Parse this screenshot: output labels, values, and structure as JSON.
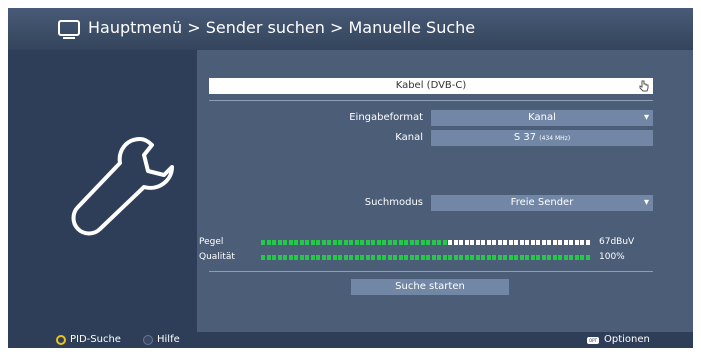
{
  "header": {
    "title": "Hauptmenü > Sender suchen > Manuelle Suche",
    "icon": "tv-icon"
  },
  "left_panel": {
    "icon": "wrench-icon"
  },
  "form": {
    "source": "Kabel (DVB-C)",
    "eingabeformat_label": "Eingabeformat",
    "eingabeformat_value": "Kanal",
    "kanal_label": "Kanal",
    "kanal_value": "S 37",
    "kanal_freq": "(434 MHz)",
    "suchmodus_label": "Suchmodus",
    "suchmodus_value": "Freie Sender"
  },
  "meters": {
    "pegel_label": "Pegel",
    "pegel_value": "67dBuV",
    "pegel_level": 0.57,
    "qualitaet_label": "Qualität",
    "qualitaet_value": "100%",
    "qualitaet_level": 1.0
  },
  "start_button": "Suche starten",
  "footer": {
    "pid_label": "PID-Suche",
    "help_label": "Hilfe",
    "options_icon_text": "OPT",
    "options_label": "Optionen"
  },
  "colors": {
    "meter_fill": "#26c84a",
    "meter_empty": "#ffffff",
    "accent_yellow": "#e8c41a"
  }
}
